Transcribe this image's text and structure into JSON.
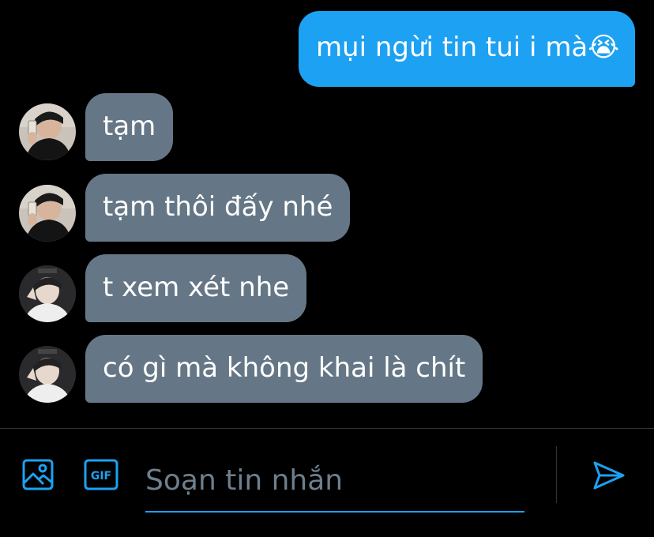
{
  "messages": [
    {
      "direction": "sent",
      "text": "mụi ngừi tin tui i mà😭"
    },
    {
      "direction": "received",
      "text": "tạm",
      "avatar": "avatar-user-a"
    },
    {
      "direction": "received",
      "text": "tạm thôi đấy nhé",
      "avatar": "avatar-user-a"
    },
    {
      "direction": "received",
      "text": "t xem xét nhe",
      "avatar": "avatar-user-b"
    },
    {
      "direction": "received",
      "text": "có gì mà không khai là chít",
      "avatar": "avatar-user-b"
    }
  ],
  "composer": {
    "placeholder": "Soạn tin nhắn",
    "value": "",
    "gif_label": "GIF",
    "icons": {
      "media": "image-icon",
      "gif": "gif-icon",
      "send": "send-icon"
    }
  },
  "colors": {
    "background": "#000000",
    "sent_bubble": "#1da1f2",
    "received_bubble": "#657786",
    "accent": "#1da1f2",
    "divider": "#2f3336"
  }
}
